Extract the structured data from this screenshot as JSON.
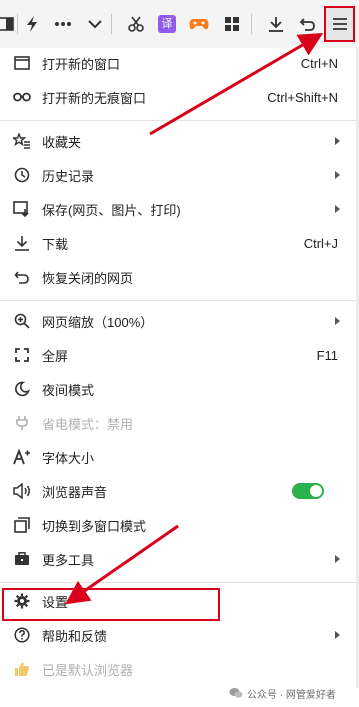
{
  "menu": {
    "items": [
      {
        "label": "打开新的窗口",
        "shortcut": "Ctrl+N"
      },
      {
        "label": "打开新的无痕窗口",
        "shortcut": "Ctrl+Shift+N"
      },
      {
        "label": "收藏夹"
      },
      {
        "label": "历史记录"
      },
      {
        "label": "保存(网页、图片、打印)"
      },
      {
        "label": "下载",
        "shortcut": "Ctrl+J"
      },
      {
        "label": "恢复关闭的网页"
      },
      {
        "label": "网页缩放（100%）"
      },
      {
        "label": "全屏",
        "shortcut": "F11"
      },
      {
        "label": "夜间模式"
      },
      {
        "label": "省电模式：禁用"
      },
      {
        "label": "字体大小"
      },
      {
        "label": "浏览器声音",
        "toggle_on": true
      },
      {
        "label": "切换到多窗口模式"
      },
      {
        "label": "更多工具"
      },
      {
        "label": "设置"
      },
      {
        "label": "帮助和反馈"
      },
      {
        "label": "已是默认浏览器"
      }
    ]
  },
  "toolbar": {
    "translate_icon_text": "译",
    "icons": [
      "split-page-icon",
      "lightning-icon",
      "more-icon",
      "chevron-down-icon",
      "scissors-icon",
      "translate-icon",
      "gamepad-icon",
      "apps-grid-icon",
      "download-icon",
      "undo-icon",
      "hamburger-menu-icon"
    ]
  },
  "watermark": {
    "text": "公众号 · 网管爱好者"
  },
  "colors": {
    "annotation_red": "#d9001b",
    "toggle_green": "#2bb24c",
    "translate_purple": "#8f5be8",
    "game_orange": "#ff7a1a"
  }
}
